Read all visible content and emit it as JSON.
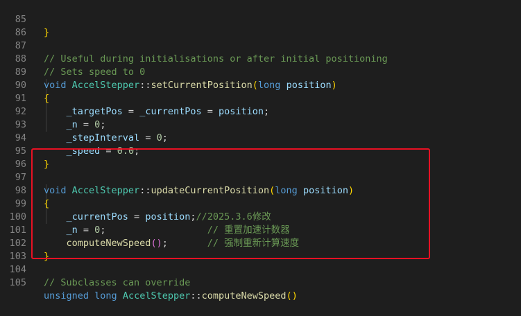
{
  "line_numbers": [
    "85",
    "86",
    "87",
    "88",
    "89",
    "90",
    "91",
    "92",
    "93",
    "94",
    "95",
    "96",
    "97",
    "98",
    "99",
    "100",
    "101",
    "102",
    "103",
    "104",
    "105"
  ],
  "code": {
    "l85": {
      "brace": "}"
    },
    "l87": {
      "comment": "// Useful during initialisations or after initial positioning"
    },
    "l88": {
      "comment": "// Sets speed to 0"
    },
    "l89": {
      "void": "void",
      "cls": "AccelStepper",
      "scope": "::",
      "fn": "setCurrentPosition",
      "paren_open": "(",
      "type": "long",
      "param": "position",
      "paren_close": ")"
    },
    "l90": {
      "brace": "{"
    },
    "l91": {
      "a": "_targetPos",
      "eq1": " = ",
      "b": "_currentPos",
      "eq2": " = ",
      "c": "position",
      "semi": ";"
    },
    "l92": {
      "a": "_n",
      "eq": " = ",
      "val": "0",
      "semi": ";"
    },
    "l93": {
      "a": "_stepInterval",
      "eq": " = ",
      "val": "0",
      "semi": ";"
    },
    "l94": {
      "a": "_speed",
      "eq": " = ",
      "val": "0.0",
      "semi": ";"
    },
    "l95": {
      "brace": "}"
    },
    "l97": {
      "void": "void",
      "cls": "AccelStepper",
      "scope": "::",
      "fn": "updateCurrentPosition",
      "paren_open": "(",
      "type": "long",
      "param": "position",
      "paren_close": ")"
    },
    "l98": {
      "brace": "{"
    },
    "l99": {
      "a": "_currentPos",
      "eq": " = ",
      "b": "position",
      "semi": ";",
      "comment": "//2025.3.6修改"
    },
    "l100": {
      "a": "_n",
      "eq": " = ",
      "val": "0",
      "semi": ";",
      "pad": "                  ",
      "comment": "// 重置加速计数器"
    },
    "l101": {
      "fn": "computeNewSpeed",
      "parens": "()",
      "semi": ";",
      "pad": "       ",
      "comment": "// 强制重新计算速度"
    },
    "l102": {
      "brace": "}"
    },
    "l104": {
      "comment": "// Subclasses can override"
    },
    "l105": {
      "kw1": "unsigned",
      "kw2": "long",
      "cls": "AccelStepper",
      "scope": "::",
      "fn": "computeNewSpeed",
      "parens": "()"
    }
  },
  "colors": {
    "background": "#1e1e1e",
    "highlight_box": "#e81123",
    "keyword": "#569cd6",
    "class": "#4ec9b0",
    "function": "#dcdcaa",
    "variable": "#9cdcfe",
    "number": "#b5cea8",
    "comment": "#6a9955"
  }
}
